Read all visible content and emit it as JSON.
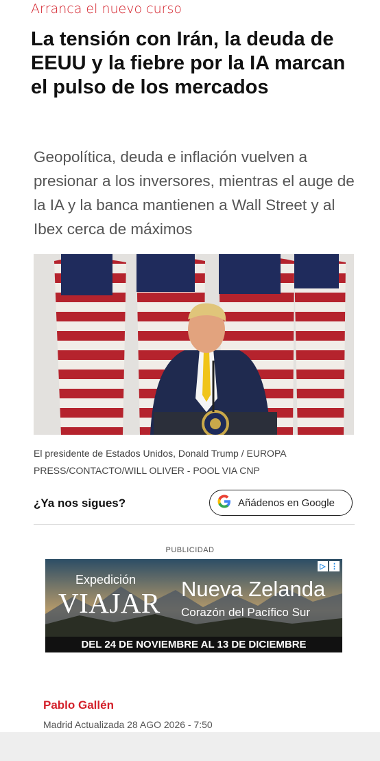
{
  "article": {
    "kicker": "Arranca el nuevo curso",
    "headline": "La tensión con Irán, la deuda de EEUU y la fiebre por la IA marcan el pulso de los mercados",
    "subtitle": "Geopolítica, deuda e inflación vuelven a presionar a los inversores, mientras el auge de la IA y la banca mantienen a Wall Street y al Ibex cerca de máximos",
    "caption": "El presidente de Estados Unidos, Donald Trump / EUROPA PRESS/CONTACTO/WILL OLIVER - POOL VIA CNP",
    "author": "Pablo Gallén",
    "dateline": "Madrid Actualizada 28 AGO 2026 - 7:50"
  },
  "follow": {
    "prompt": "¿Ya nos sigues?",
    "button_label": "Añádenos en Google",
    "icon": "google-g-icon"
  },
  "ad": {
    "label": "PUBLICIDAD",
    "brand_top": "Expedición",
    "brand": "VIAJAR",
    "destination": "Nueva Zelanda",
    "tagline": "Corazón del Pacífico Sur",
    "dates": "DEL 24 DE NOVIEMBRE AL 13 DE DICIEMBRE",
    "badge_icons": [
      "adchoices-icon",
      "more-vert-icon"
    ]
  },
  "colors": {
    "accent": "#d3202a",
    "text": "#111111",
    "muted": "#555555"
  }
}
